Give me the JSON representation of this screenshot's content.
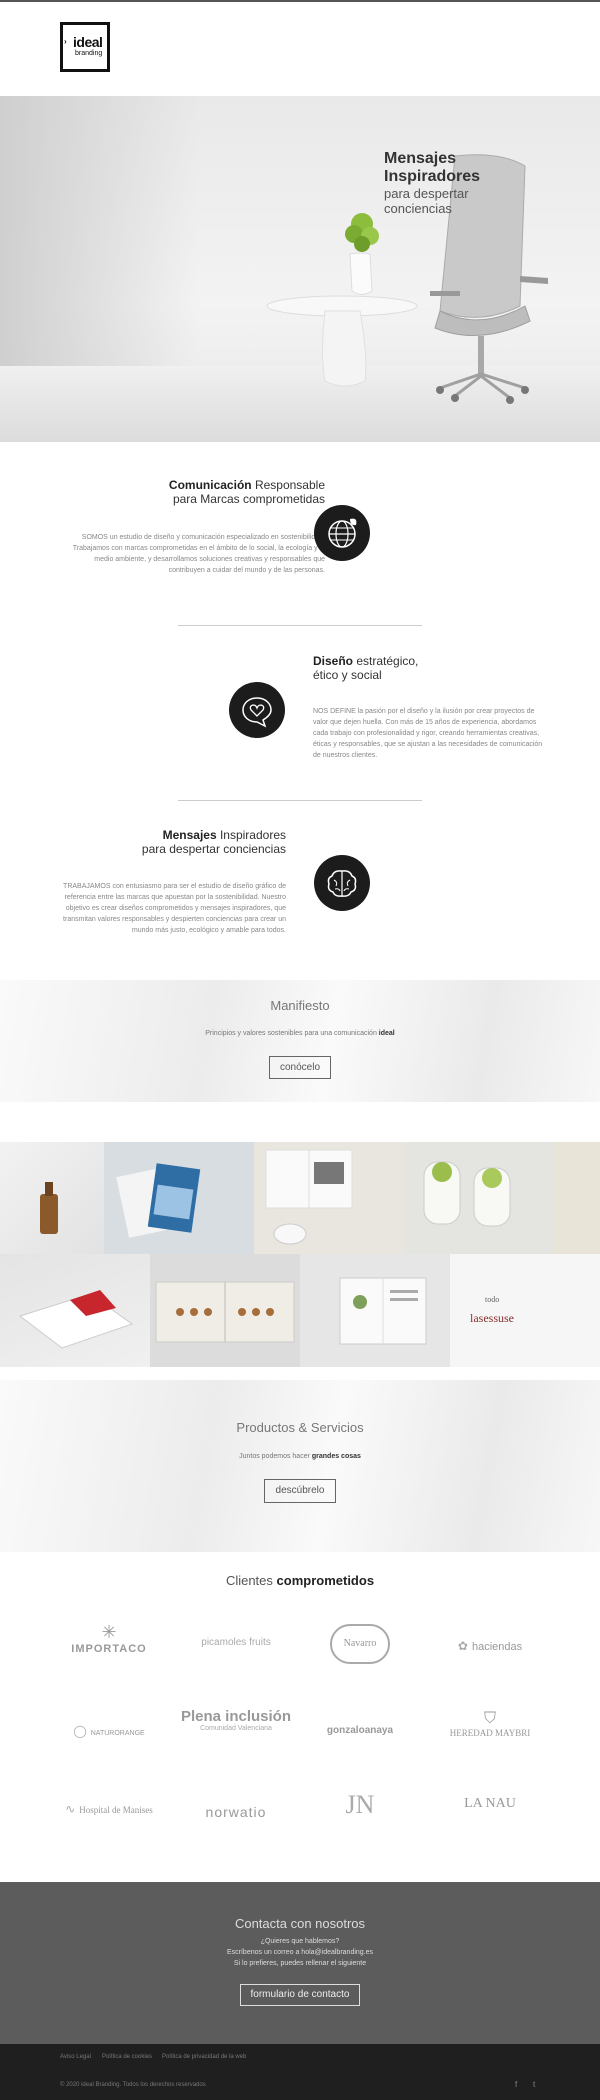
{
  "brand": {
    "logo_word": "ideal",
    "logo_sub": "branding"
  },
  "hero": {
    "title1": "Mensajes",
    "title2": "Inspiradores",
    "sub1": "para despertar",
    "sub2": "conciencias"
  },
  "section1": {
    "title_bold": "Comunicación",
    "title_rest": " Responsable",
    "title_line2": "para Marcas comprometidas",
    "text": "SOMOS un estudio de diseño y comunicación especializado en sostenibilidad. Trabajamos con marcas comprometidas en el ámbito de lo social, la ecología y el medio ambiente, y desarrollamos soluciones creativas y responsables que contribuyen a cuidar del mundo y de las personas.",
    "icon": "globe-leaf-icon"
  },
  "section2": {
    "title_bold": "Diseño",
    "title_rest": " estratégico,",
    "title_line2": "ético y social",
    "text": "NOS DEFINE la pasión por el diseño y la ilusión por crear proyectos de valor que dejen huella. Con más de 15 años de experiencia, abordamos cada trabajo con profesionalidad y rigor, creando herramientas creativas, éticas y responsables, que se ajustan a las necesidades de comunicación de nuestros clientes.",
    "icon": "heart-bubble-icon"
  },
  "section3": {
    "title_bold": "Mensajes",
    "title_rest": " Inspiradores",
    "title_line2": "para despertar conciencias",
    "text": "TRABAJAMOS con entusiasmo para ser el estudio de diseño gráfico de referencia entre las marcas que apuestan por la sostenibilidad. Nuestro objetivo es crear diseños comprometidos y mensajes inspiradores, que transmitan valores responsables y despierten conciencias para crear un mundo más justo, ecológico y amable para todos.",
    "icon": "brain-icon"
  },
  "manifiesto": {
    "title": "Manifiesto",
    "sub": "Principios y valores sostenibles para una comunicación",
    "sub_bold": "ideal",
    "button": "conócelo"
  },
  "productos": {
    "title": "Productos & Servicios",
    "sub": "Juntos podemos hacer",
    "sub_bold": "grandes cosas",
    "button": "descúbrelo"
  },
  "clients": {
    "title": "Clientes",
    "title_bold": "comprometidos",
    "logos": [
      "IMPORTACO",
      "picamoles fruits",
      "Navarro",
      "haciendas",
      "NATURORANGE",
      "Plena inclusión",
      "gonzaloanaya",
      "HEREDAD MAYBRI",
      "Hospital de Manises",
      "norwatio",
      "JN",
      "LA NAU"
    ]
  },
  "contact": {
    "title": "Contacta con nosotros",
    "line1": "¿Quieres que hablemos?",
    "line2": "Escríbenos un correo a hola@idealbranding.es",
    "line3": "Si lo prefieres, puedes rellenar el siguiente",
    "button": "formulario de contacto"
  },
  "footer": {
    "links": [
      "Aviso Legal",
      "Política de cookies",
      "Política de privacidad de la web"
    ],
    "copyright": "© 2020 ideal Branding. Todos los derechos reservados",
    "social": [
      "f",
      "t"
    ]
  },
  "colors": {
    "dark": "#1c1c1c",
    "contact_bg": "#5c5c5c",
    "footer_bg": "#1f1f1f"
  }
}
